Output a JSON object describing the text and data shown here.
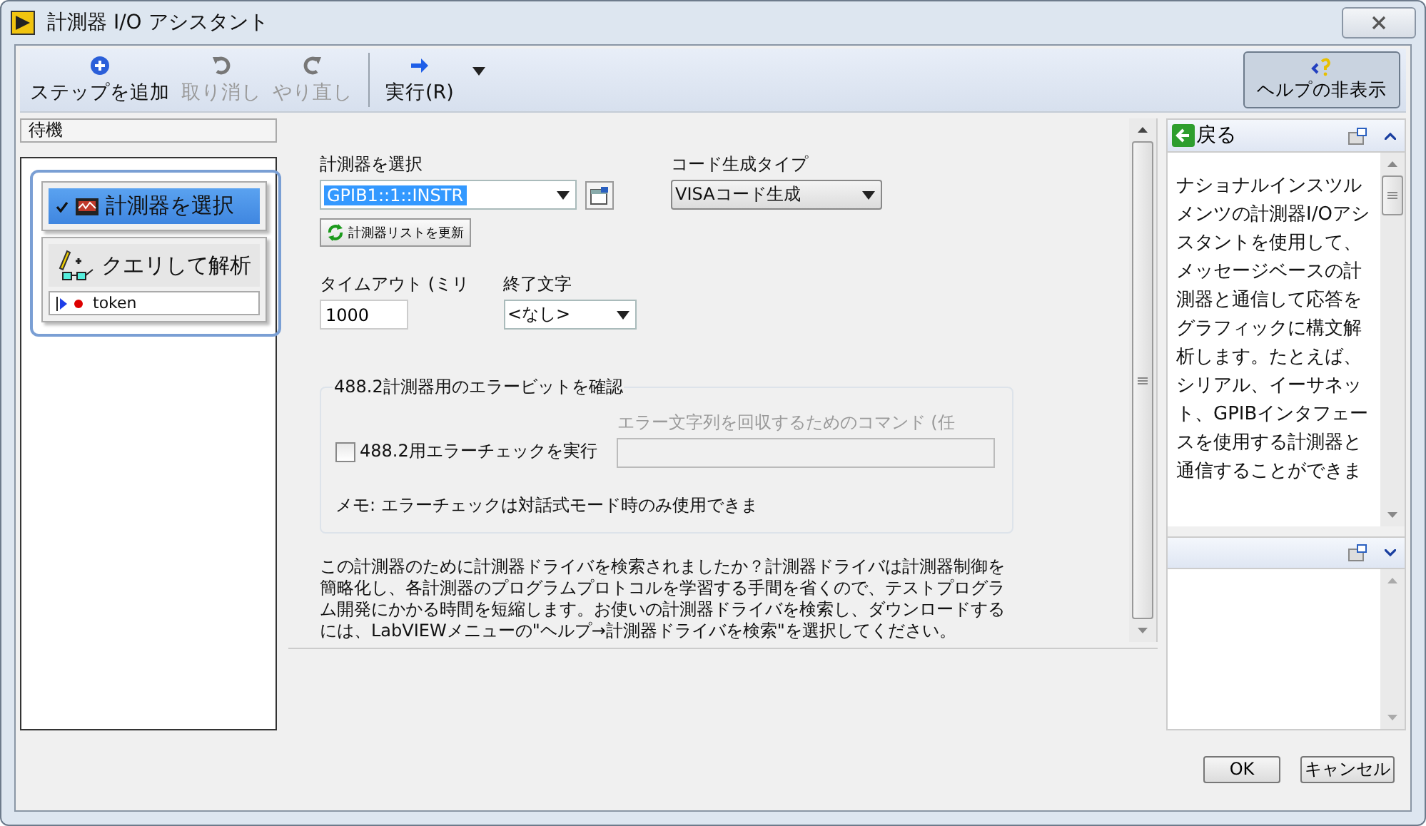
{
  "window": {
    "title": "計測器 I/O アシスタント"
  },
  "toolbar": {
    "buttons": [
      {
        "label": "ステップを追加",
        "kind": "add",
        "disabled": false
      },
      {
        "label": "取り消し",
        "kind": "undo",
        "disabled": true
      },
      {
        "label": "やり直し",
        "kind": "redo",
        "disabled": true
      },
      {
        "label": "実行(R)",
        "kind": "run",
        "disabled": false
      }
    ],
    "help_toggle": "ヘルプの非表示"
  },
  "sequence": {
    "status": "待機",
    "steps": [
      {
        "label": "計測器を選択",
        "kind": "select",
        "selected": true,
        "checked": true
      },
      {
        "label": "クエリして解析",
        "kind": "query",
        "selected": false,
        "checked": false,
        "tokens": [
          "token"
        ]
      }
    ]
  },
  "form": {
    "instrument": {
      "label": "計測器を選択",
      "value": "GPIB1::1::INSTR"
    },
    "refresh_button": "計測器リストを更新",
    "code_type": {
      "label": "コード生成タイプ",
      "value": "VISAコード生成"
    },
    "timeout": {
      "label": "タイムアウト (ミリ",
      "value": "1000"
    },
    "termination": {
      "label": "終了文字",
      "value": "<なし>"
    },
    "error_group": {
      "title": "488.2計測器用のエラービットを確認",
      "checkbox": {
        "label": "488.2用エラーチェックを実行",
        "checked": false
      },
      "command_label": "エラー文字列を回収するためのコマンド (任",
      "note": "メモ: エラーチェックは対話式モード時のみ使用できま"
    },
    "description": "この計測器のために計測器ドライバを検索されましたか？計測器ドライバは計測器制御を簡略化し、各計測器のプログラムプロトコルを学習する手間を省くので、テストプログラム開発にかかる時間を短縮します。お使いの計測器ドライバを検索し、ダウンロードするには、LabVIEWメニューの\"ヘルプ→計測器ドライバを検索\"を選択してください。"
  },
  "help": {
    "back": "戻る",
    "text": "ナショナルインスツルメンツの計測器I/Oアシスタントを使用して、メッセージベースの計測器と通信して応答をグラフィックに構文解析します。たとえば、シリアル、イーサネット、GPIBインタフェースを使用する計測器と通信することができま"
  },
  "buttons": [
    "OK",
    "キャンセル"
  ]
}
